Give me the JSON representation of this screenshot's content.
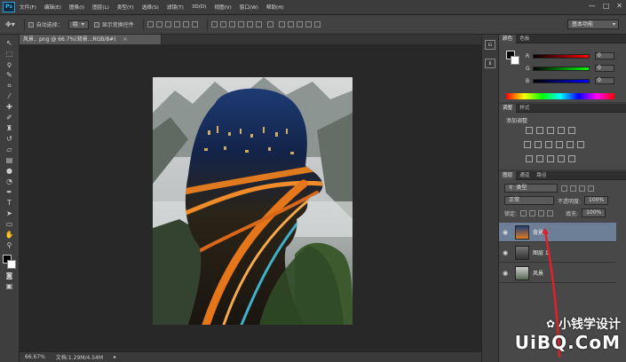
{
  "app": {
    "logo": "Ps"
  },
  "menu": [
    "文件(F)",
    "编辑(E)",
    "图像(I)",
    "图层(L)",
    "类型(Y)",
    "选择(S)",
    "滤镜(T)",
    "3D(D)",
    "视图(V)",
    "窗口(W)",
    "帮助(H)"
  ],
  "window_buttons": [
    "—",
    "□",
    "✕"
  ],
  "options": {
    "auto_select_label": "自动选择：",
    "auto_select_value": "组",
    "transform_label": "显示变换控件",
    "workspace": "基本功能"
  },
  "document": {
    "tab_title": "风景．png @ 66.7%(背景...",
    "tab_mode": "RGB/8#)",
    "close": "×"
  },
  "status": {
    "zoom": "66.67%",
    "doc_size": "文档:1.29M/4.54M"
  },
  "color_panel": {
    "tabs": [
      "颜色",
      "色板"
    ],
    "channels": [
      {
        "label": "R",
        "value": "0",
        "track": "linear-gradient(to right,#000,#f00)"
      },
      {
        "label": "G",
        "value": "0",
        "track": "linear-gradient(to right,#000,#0f0)"
      },
      {
        "label": "B",
        "value": "0",
        "track": "linear-gradient(to right,#000,#00f)"
      }
    ]
  },
  "adjust_panel": {
    "tabs": [
      "调整",
      "样式"
    ],
    "title": "添加调整"
  },
  "layers_panel": {
    "tabs": [
      "图层",
      "通道",
      "路径"
    ],
    "filter": "类型",
    "blend": "正常",
    "opacity_label": "不透明度:",
    "opacity": "100%",
    "lock_label": "锁定:",
    "fill_label": "填充:",
    "fill": "100%",
    "layers": [
      {
        "name": "背景",
        "selected": true
      },
      {
        "name": "图层 1",
        "selected": false
      },
      {
        "name": "风景",
        "selected": false
      }
    ]
  },
  "watermark": {
    "cn": "小钱学设计",
    "en": "UiBQ.CoM"
  },
  "colors": {
    "accent": "#2aa3e0",
    "layer_selected": "#6c7f96",
    "annotation_arrow": "#e0202a"
  }
}
